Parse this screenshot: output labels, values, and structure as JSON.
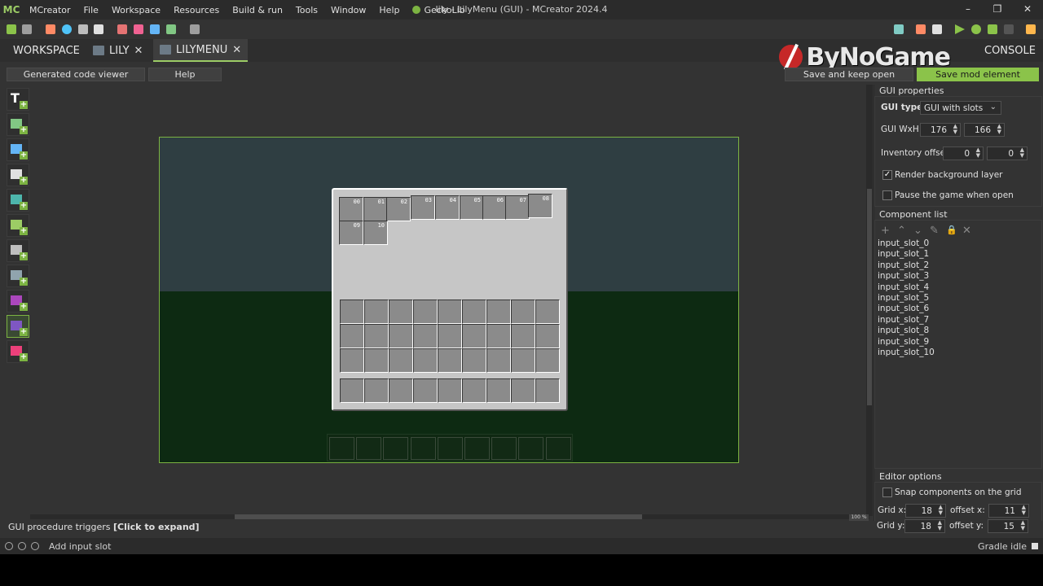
{
  "app": {
    "logo": "MC",
    "window_title": "lily - LilyMenu (GUI) - MCreator 2024.4",
    "menu": [
      "MCreator",
      "File",
      "Workspace",
      "Resources",
      "Build & run",
      "Tools",
      "Window",
      "Help"
    ],
    "plugin_menu": "GeckoLib"
  },
  "tabs": {
    "workspace": "WORKSPACE",
    "lily": "LILY",
    "lilymenu": "LILYMENU",
    "console": "CONSOLE",
    "close_glyph": "✕"
  },
  "editor": {
    "code_viewer": "Generated code viewer",
    "help": "Help",
    "save_keep_open": "Save and keep open",
    "save_mod_element": "Save mod element"
  },
  "watermark": "ByNoGame",
  "gui": {
    "input_slots": [
      {
        "label": "00"
      },
      {
        "label": "01"
      },
      {
        "label": "02"
      },
      {
        "label": "03"
      },
      {
        "label": "04"
      },
      {
        "label": "05"
      },
      {
        "label": "06"
      },
      {
        "label": "07"
      },
      {
        "label": "08"
      },
      {
        "label": "09"
      },
      {
        "label": "10"
      }
    ]
  },
  "zoom": "100 %",
  "properties": {
    "section": "GUI properties",
    "gui_type_label": "GUI type:",
    "gui_type_value": "GUI with slots",
    "gui_wxh_label": "GUI WxH:",
    "gui_w": "176",
    "gui_h": "166",
    "inventory_offset_label": "Inventory offset:",
    "inv_x": "0",
    "inv_y": "0",
    "render_bg": "Render background layer",
    "render_bg_checked": true,
    "pause_game": "Pause the game when open",
    "pause_game_checked": false
  },
  "component_list": {
    "section": "Component list",
    "items": [
      "input_slot_0",
      "input_slot_1",
      "input_slot_2",
      "input_slot_3",
      "input_slot_4",
      "input_slot_5",
      "input_slot_6",
      "input_slot_7",
      "input_slot_8",
      "input_slot_9",
      "input_slot_10"
    ]
  },
  "editor_options": {
    "section": "Editor options",
    "snap": "Snap components on the grid",
    "grid_x_label": "Grid x:",
    "grid_x": "18",
    "offset_x_label": "offset x:",
    "offset_x": "11",
    "grid_y_label": "Grid y:",
    "grid_y": "18",
    "offset_y_label": "offset y:",
    "offset_y": "15"
  },
  "triggers": {
    "label": "GUI procedure triggers",
    "action": "[Click to expand]"
  },
  "status": {
    "hint": "Add input slot",
    "gradle": "Gradle idle"
  },
  "colors": {
    "accent": "#8bc34a",
    "sky": "#2f3e42",
    "ground": "#0d2a12"
  }
}
